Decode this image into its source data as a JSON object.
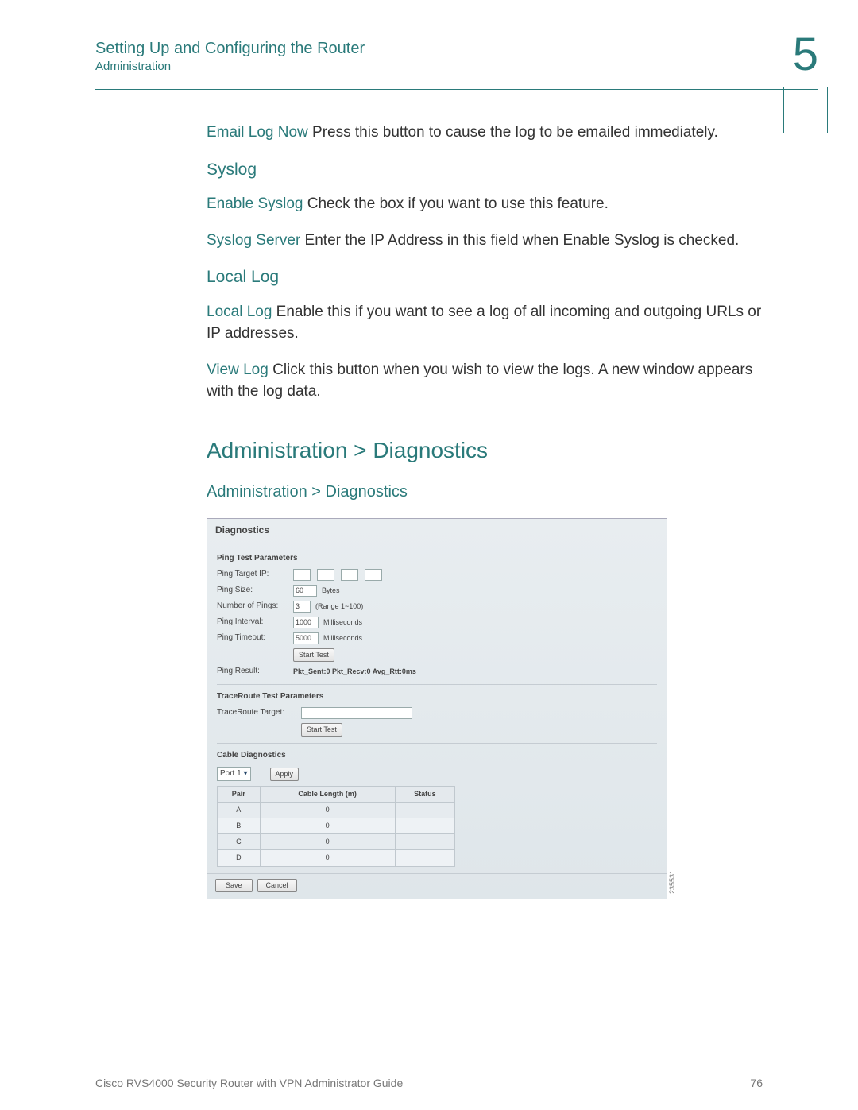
{
  "header": {
    "title": "Setting Up and Configuring the Router",
    "subtitle": "Administration",
    "chapter": "5"
  },
  "body": {
    "email_log_term": "Email Log Now",
    "email_log_text": " Press this button to cause the log to be emailed immediately.",
    "syslog_heading": "Syslog",
    "enable_syslog_term": "Enable Syslog",
    "enable_syslog_text": " Check the box if you want to use this feature.",
    "syslog_server_term": "Syslog Server",
    "syslog_server_text": " Enter the IP Address in this field when Enable Syslog is checked.",
    "local_log_heading": "Local Log",
    "local_log_term": "Local Log",
    "local_log_text": " Enable this if you want to see a log of all incoming and outgoing URLs or IP addresses.",
    "view_log_term": "View Log",
    "view_log_text": " Click this button when you wish to view the logs. A new window appears with the log data.",
    "h2": "Administration > Diagnostics",
    "h4": "Administration > Diagnostics"
  },
  "screenshot": {
    "title": "Diagnostics",
    "ping_section": "Ping Test Parameters",
    "labels": {
      "ping_target_ip": "Ping Target IP:",
      "ping_size": "Ping Size:",
      "num_pings": "Number of Pings:",
      "ping_interval": "Ping Interval:",
      "ping_timeout": "Ping Timeout:",
      "ping_result": "Ping Result:"
    },
    "values": {
      "ping_size": "60",
      "ping_size_unit": "Bytes",
      "num_pings": "3",
      "num_pings_unit": "(Range 1~100)",
      "ping_interval": "1000",
      "ping_interval_unit": "Milliseconds",
      "ping_timeout": "5000",
      "ping_timeout_unit": "Milliseconds",
      "start_test": "Start Test",
      "ping_result_text": "Pkt_Sent:0 Pkt_Recv:0 Avg_Rtt:0ms"
    },
    "traceroute_section": "TraceRoute Test Parameters",
    "traceroute_label": "TraceRoute Target:",
    "cable_section": "Cable Diagnostics",
    "cable": {
      "port": "Port 1",
      "apply": "Apply",
      "headers": {
        "pair": "Pair",
        "length": "Cable Length (m)",
        "status": "Status"
      },
      "rows": [
        {
          "pair": "A",
          "length": "0",
          "status": ""
        },
        {
          "pair": "B",
          "length": "0",
          "status": ""
        },
        {
          "pair": "C",
          "length": "0",
          "status": ""
        },
        {
          "pair": "D",
          "length": "0",
          "status": ""
        }
      ]
    },
    "footer": {
      "save": "Save",
      "cancel": "Cancel"
    },
    "side_number": "235531"
  },
  "footer": {
    "left": "Cisco RVS4000 Security Router with VPN Administrator Guide",
    "right": "76"
  }
}
